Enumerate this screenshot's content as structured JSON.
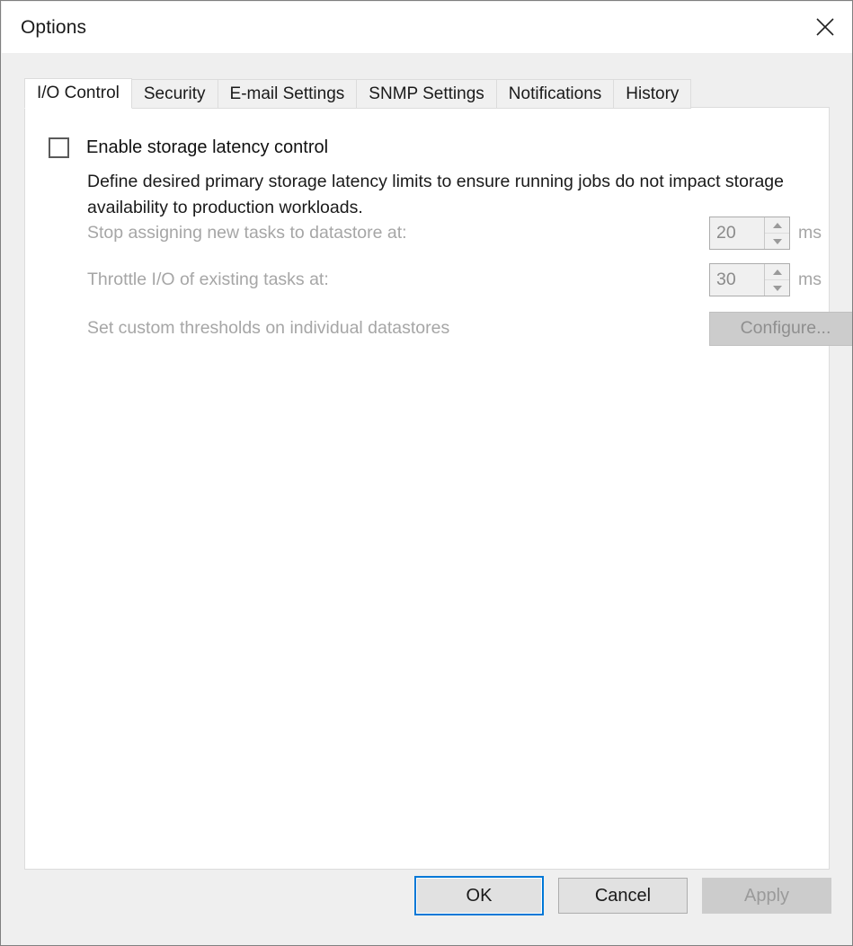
{
  "window": {
    "title": "Options",
    "close_icon": "close-icon"
  },
  "tabs": [
    {
      "label": "I/O Control",
      "active": true
    },
    {
      "label": "Security",
      "active": false
    },
    {
      "label": "E-mail Settings",
      "active": false
    },
    {
      "label": "SNMP Settings",
      "active": false
    },
    {
      "label": "Notifications",
      "active": false
    },
    {
      "label": "History",
      "active": false
    }
  ],
  "io_control": {
    "enable_checkbox_label": "Enable storage latency control",
    "enable_checkbox_checked": false,
    "description": "Define desired primary storage latency limits to ensure running jobs do not impact storage availability to production workloads.",
    "fields": [
      {
        "label": "Stop assigning new tasks to datastore at:",
        "value": "20",
        "unit": "ms",
        "spin_up_icon": "chevron-up-icon",
        "spin_down_icon": "chevron-down-icon"
      },
      {
        "label": "Throttle I/O of existing tasks at:",
        "value": "30",
        "unit": "ms",
        "spin_up_icon": "chevron-up-icon",
        "spin_down_icon": "chevron-down-icon"
      }
    ],
    "custom_thresholds": {
      "label": "Set custom thresholds on individual datastores",
      "button_label": "Configure..."
    }
  },
  "footer": {
    "ok_label": "OK",
    "cancel_label": "Cancel",
    "apply_label": "Apply"
  },
  "colors": {
    "accent_focus": "#0078D7",
    "dialog_bg": "#EFEFEF",
    "panel_bg": "#FFFFFF",
    "disabled_text": "#A6A6A6",
    "button_bg": "#E1E1E1",
    "button_disabled_bg": "#CCCCCC"
  }
}
